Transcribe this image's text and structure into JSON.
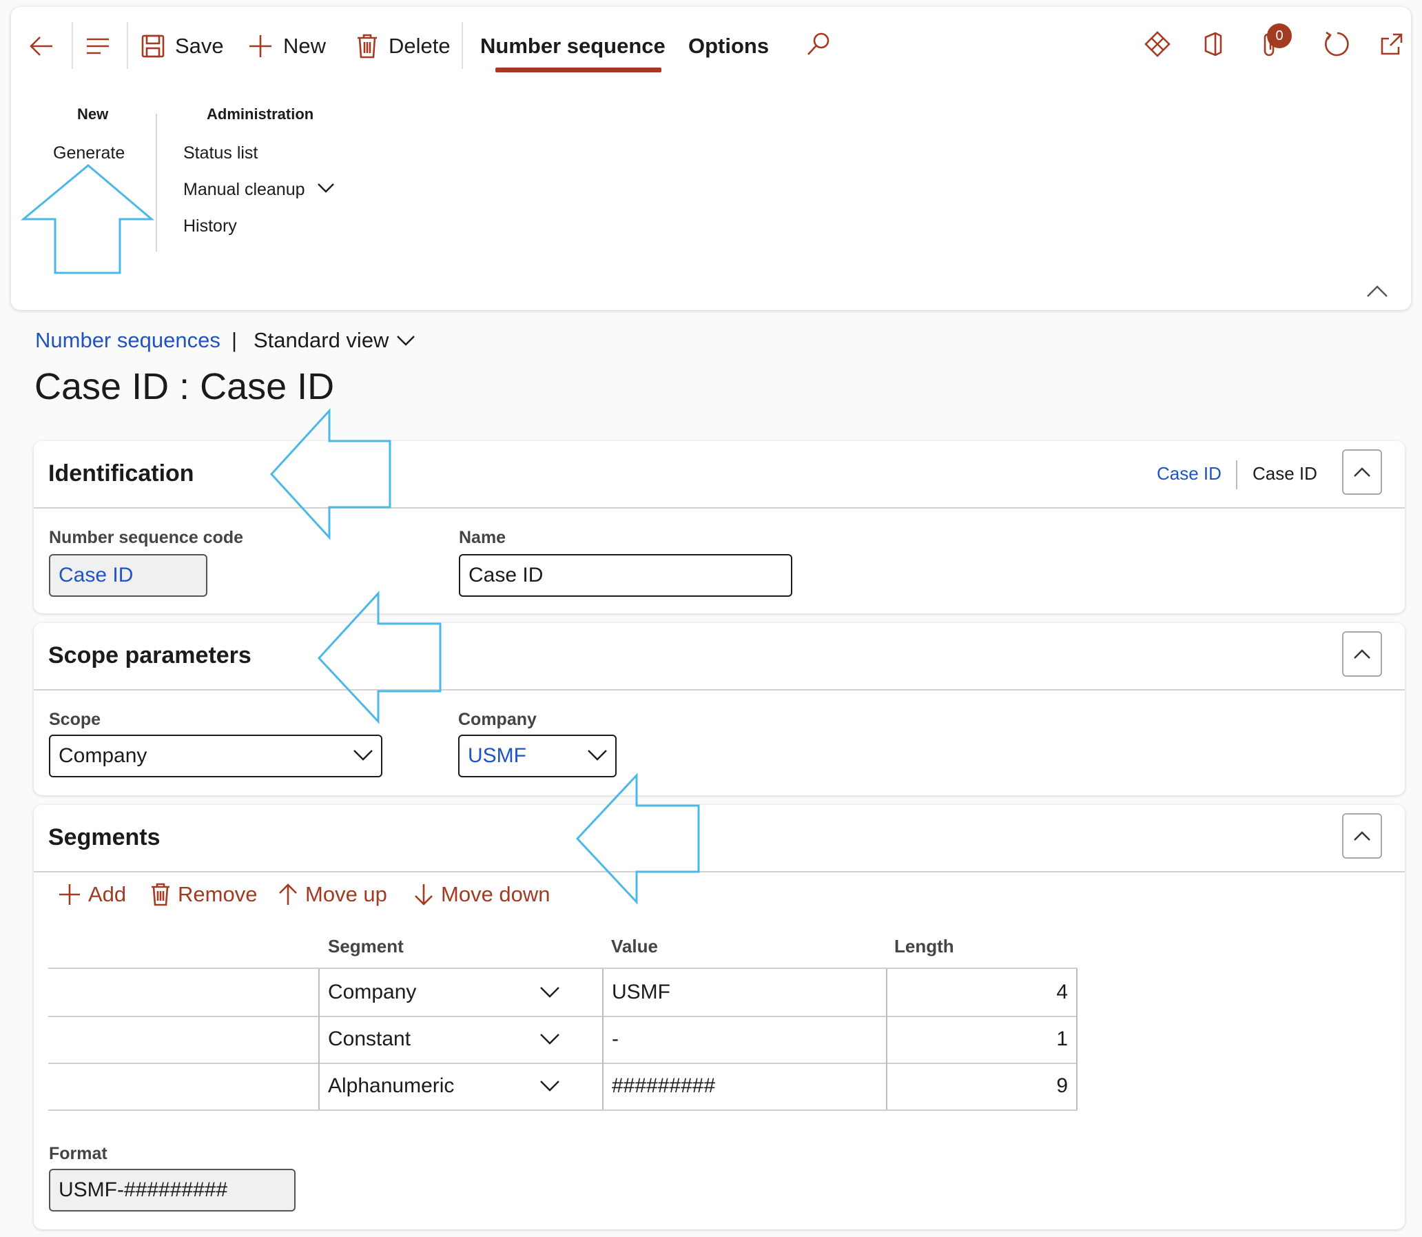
{
  "toolbar": {
    "save": "Save",
    "new": "New",
    "delete": "Delete",
    "tab_number_sequence": "Number sequence",
    "tab_options": "Options",
    "badge_count": "0"
  },
  "ribbon": {
    "group_new": {
      "title": "New",
      "items": [
        "Generate"
      ]
    },
    "group_admin": {
      "title": "Administration",
      "items": [
        "Status list",
        "Manual cleanup",
        "History"
      ]
    }
  },
  "breadcrumb": {
    "link": "Number sequences",
    "separator": "|",
    "view": "Standard view"
  },
  "page_title": "Case ID : Case ID",
  "identification": {
    "title": "Identification",
    "summary_code": "Case ID",
    "summary_name": "Case ID",
    "code_label": "Number sequence code",
    "code_value": "Case ID",
    "name_label": "Name",
    "name_value": "Case ID"
  },
  "scope": {
    "title": "Scope parameters",
    "scope_label": "Scope",
    "scope_value": "Company",
    "company_label": "Company",
    "company_value": "USMF"
  },
  "segments": {
    "title": "Segments",
    "actions": {
      "add": "Add",
      "remove": "Remove",
      "move_up": "Move up",
      "move_down": "Move down"
    },
    "columns": {
      "segment": "Segment",
      "value": "Value",
      "length": "Length"
    },
    "rows": [
      {
        "segment": "Company",
        "value": "USMF",
        "length": "4"
      },
      {
        "segment": "Constant",
        "value": "-",
        "length": "1"
      },
      {
        "segment": "Alphanumeric",
        "value": "#########",
        "length": "9"
      }
    ],
    "format_label": "Format",
    "format_value": "USMF-#########"
  },
  "colors": {
    "accent": "#a33b22",
    "link": "#1f54c4",
    "annotation": "#4cb8e8"
  }
}
